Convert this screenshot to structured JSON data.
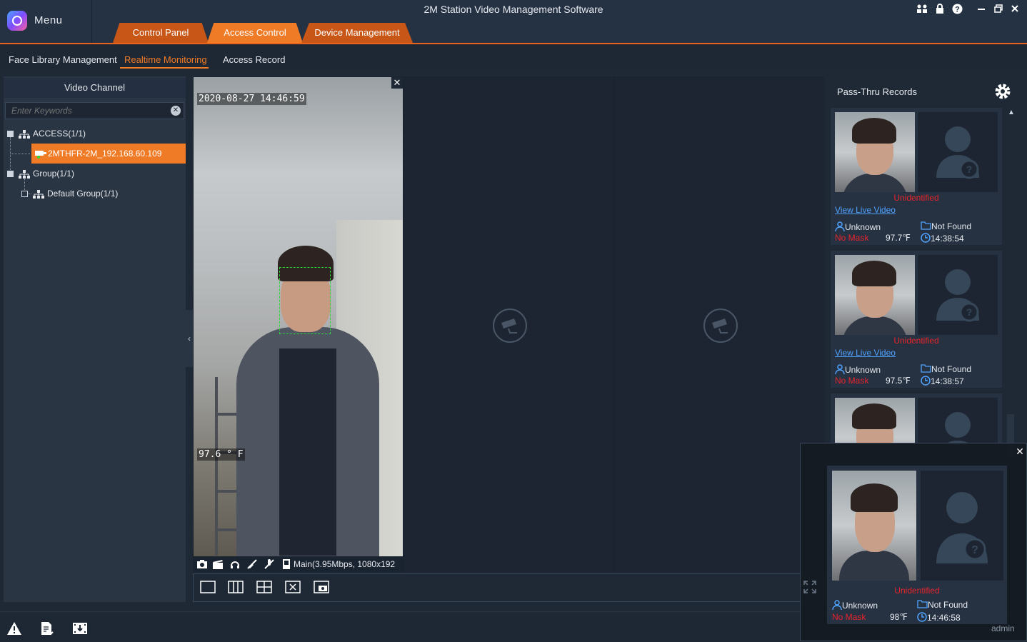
{
  "app": {
    "title": "2M Station Video Management Software",
    "menu_label": "Menu",
    "user": "admin"
  },
  "main_tabs": [
    {
      "label": "Control Panel",
      "active": false
    },
    {
      "label": "Access Control",
      "active": true
    },
    {
      "label": "Device Management",
      "active": false
    }
  ],
  "sub_tabs": [
    {
      "label": "Face Library Management",
      "active": false
    },
    {
      "label": "Realtime Monitoring",
      "active": true
    },
    {
      "label": "Access Record",
      "active": false
    }
  ],
  "video_channel": {
    "header": "Video Channel",
    "search_placeholder": "Enter Keywords",
    "tree": {
      "access_group": "ACCESS(1/1)",
      "device": "2MTHFR-2M_192.168.60.109",
      "group": "Group(1/1)",
      "default_group": "Default Group(1/1)"
    }
  },
  "live_view": {
    "timestamp": "2020-08-27 14:46:59",
    "temperature_osd": "97.6 ° F",
    "stream_info": "Main(3.95Mbps, 1080x192"
  },
  "pass_thru": {
    "title": "Pass-Thru Records",
    "view_live_label": "View Live Video",
    "records": [
      {
        "status": "Unidentified",
        "name": "Unknown",
        "match": "Not Found",
        "mask": "No Mask",
        "temp": "97.7℉",
        "time": "14:38:54"
      },
      {
        "status": "Unidentified",
        "name": "Unknown",
        "match": "Not Found",
        "mask": "No Mask",
        "temp": "97.5℉",
        "time": "14:38:57"
      }
    ]
  },
  "popup_record": {
    "status": "Unidentified",
    "name": "Unknown",
    "match": "Not Found",
    "mask": "No Mask",
    "temp": "98℉",
    "time": "14:46:58"
  },
  "colors": {
    "accent": "#f07b26",
    "alert": "#e8232b",
    "link": "#4fa3ff",
    "background": "#1f2936"
  }
}
